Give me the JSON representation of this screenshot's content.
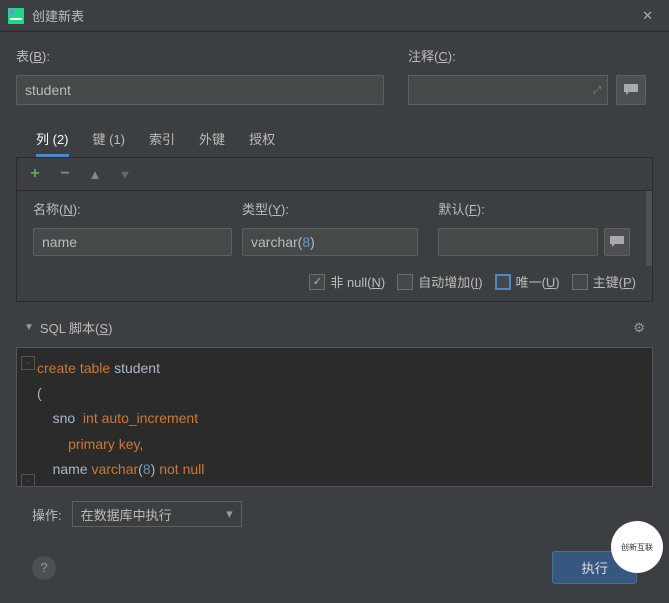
{
  "window": {
    "title": "创建新表"
  },
  "tableField": {
    "label_pre": "表(",
    "label_u": "B",
    "label_post": "):",
    "value": "student"
  },
  "commentField": {
    "label_pre": "注释(",
    "label_u": "C",
    "label_post": "):"
  },
  "tabs": {
    "cols": "列 (2)",
    "keys": "键 (1)",
    "indexes": "索引",
    "fks": "外键",
    "auth": "授权"
  },
  "colEditor": {
    "name": {
      "label_pre": "名称(",
      "label_u": "N",
      "label_post": "):",
      "value": "name"
    },
    "type": {
      "label_pre": "类型(",
      "label_u": "Y",
      "label_post": "):",
      "value_pre": "varchar(",
      "value_num": "8",
      "value_post": ")"
    },
    "default": {
      "label_pre": "默认(",
      "label_u": "F",
      "label_post": "):",
      "value": ""
    }
  },
  "checks": {
    "notnull": {
      "label_pre": "非 null(",
      "label_u": "N",
      "label_post": ")"
    },
    "autoinc": {
      "label_pre": "自动增加(",
      "label_u": "I",
      "label_post": ")"
    },
    "unique": {
      "label_pre": "唯一(",
      "label_u": "U",
      "label_post": ")"
    },
    "pk": {
      "label_pre": "主键(",
      "label_u": "P",
      "label_post": ")"
    }
  },
  "sqlSection": {
    "label_pre": "SQL 脚本(",
    "label_u": "S",
    "label_post": ")"
  },
  "sql": {
    "kw_create": "create",
    "kw_table": "table",
    "ident_student": "student",
    "open": "(",
    "ident_sno": "sno",
    "kw_int": "int",
    "kw_autoinc": "auto_increment",
    "kw_primary": "primary",
    "kw_key": "key,",
    "ident_name": "name",
    "kw_varchar": "varchar",
    "p_open": "(",
    "num_8": "8",
    "p_close": ")",
    "kw_not": "not",
    "kw_null": "null",
    "close": ")"
  },
  "footer": {
    "action_label": "操作:",
    "action_value": "在数据库中执行",
    "execute": "执行",
    "help": "?"
  },
  "watermark": "创新互联"
}
